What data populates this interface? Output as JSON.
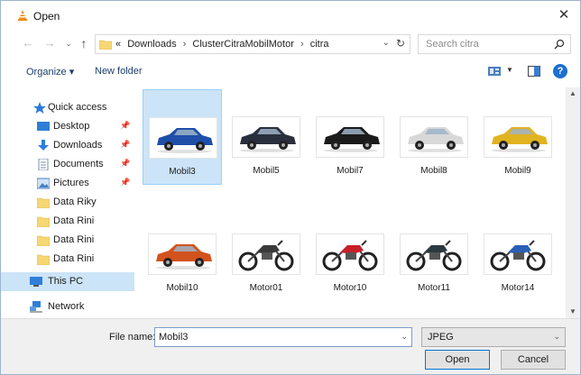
{
  "window": {
    "title": "Open",
    "close_glyph": "✕"
  },
  "nav": {
    "back_glyph": "←",
    "forward_glyph": "→",
    "recent_glyph": "⌄",
    "up_glyph": "↑",
    "address_prefix": "«",
    "path": [
      "Downloads",
      "ClusterCitraMobilMotor",
      "citra"
    ],
    "path_sep": "›",
    "dropdown_glyph": "⌄",
    "refresh_glyph": "↻",
    "search_placeholder": "Search citra"
  },
  "toolbar": {
    "organize_label": "Organize ▾",
    "new_folder_label": "New folder",
    "view_drop_glyph": "▼",
    "help_glyph": "?"
  },
  "sidebar": {
    "items": [
      {
        "label": "Quick access",
        "icon": "star-icon",
        "pinned": false
      },
      {
        "label": "Desktop",
        "icon": "desktop-icon",
        "pinned": true
      },
      {
        "label": "Downloads",
        "icon": "download-icon",
        "pinned": true
      },
      {
        "label": "Documents",
        "icon": "documents-icon",
        "pinned": true
      },
      {
        "label": "Pictures",
        "icon": "pictures-icon",
        "pinned": true
      },
      {
        "label": "Data Riky",
        "icon": "folder-icon",
        "pinned": false
      },
      {
        "label": "Data Rini",
        "icon": "folder-icon",
        "pinned": false
      },
      {
        "label": "Data Rini",
        "icon": "folder-icon",
        "pinned": false
      },
      {
        "label": "Data Rini",
        "icon": "folder-icon",
        "pinned": false
      },
      {
        "label": "This PC",
        "icon": "computer-icon",
        "pinned": false
      },
      {
        "label": "Network",
        "icon": "network-icon",
        "pinned": false
      }
    ],
    "pin_glyph": "📌"
  },
  "files": [
    {
      "name": "Mobil3",
      "kind": "car",
      "color": "#1f4fa8",
      "selected": true
    },
    {
      "name": "Mobil5",
      "kind": "car",
      "color": "#2a2f3d",
      "selected": false
    },
    {
      "name": "Mobil7",
      "kind": "car",
      "color": "#1b1b1b",
      "selected": false
    },
    {
      "name": "Mobil8",
      "kind": "car",
      "color": "#d8d8d8",
      "selected": false
    },
    {
      "name": "Mobil9",
      "kind": "car",
      "color": "#e2b321",
      "selected": false
    },
    {
      "name": "Mobil10",
      "kind": "car",
      "color": "#d2521e",
      "selected": false
    },
    {
      "name": "Motor01",
      "kind": "motor",
      "color": "#3a3a3a",
      "selected": false
    },
    {
      "name": "Motor10",
      "kind": "motor",
      "color": "#c8202a",
      "selected": false
    },
    {
      "name": "Motor11",
      "kind": "motor",
      "color": "#2c3a40",
      "selected": false
    },
    {
      "name": "Motor14",
      "kind": "motor",
      "color": "#2a5fb8",
      "selected": false
    },
    {
      "name": "",
      "kind": "motor",
      "color": "#3a7fa0",
      "selected": false
    },
    {
      "name": "",
      "kind": "motor",
      "color": "#5a5a5a",
      "selected": false
    }
  ],
  "scroll": {
    "up_glyph": "▲",
    "down_glyph": "▼"
  },
  "bottom": {
    "file_name_label": "File name:",
    "file_name_value": "Mobil3",
    "file_type_value": "JPEG",
    "drop_glyph": "⌄",
    "open_label": "Open",
    "cancel_label": "Cancel"
  },
  "colors": {
    "accent": "#0078d7",
    "selection": "#cce4f7",
    "folder": "#f7d774"
  }
}
